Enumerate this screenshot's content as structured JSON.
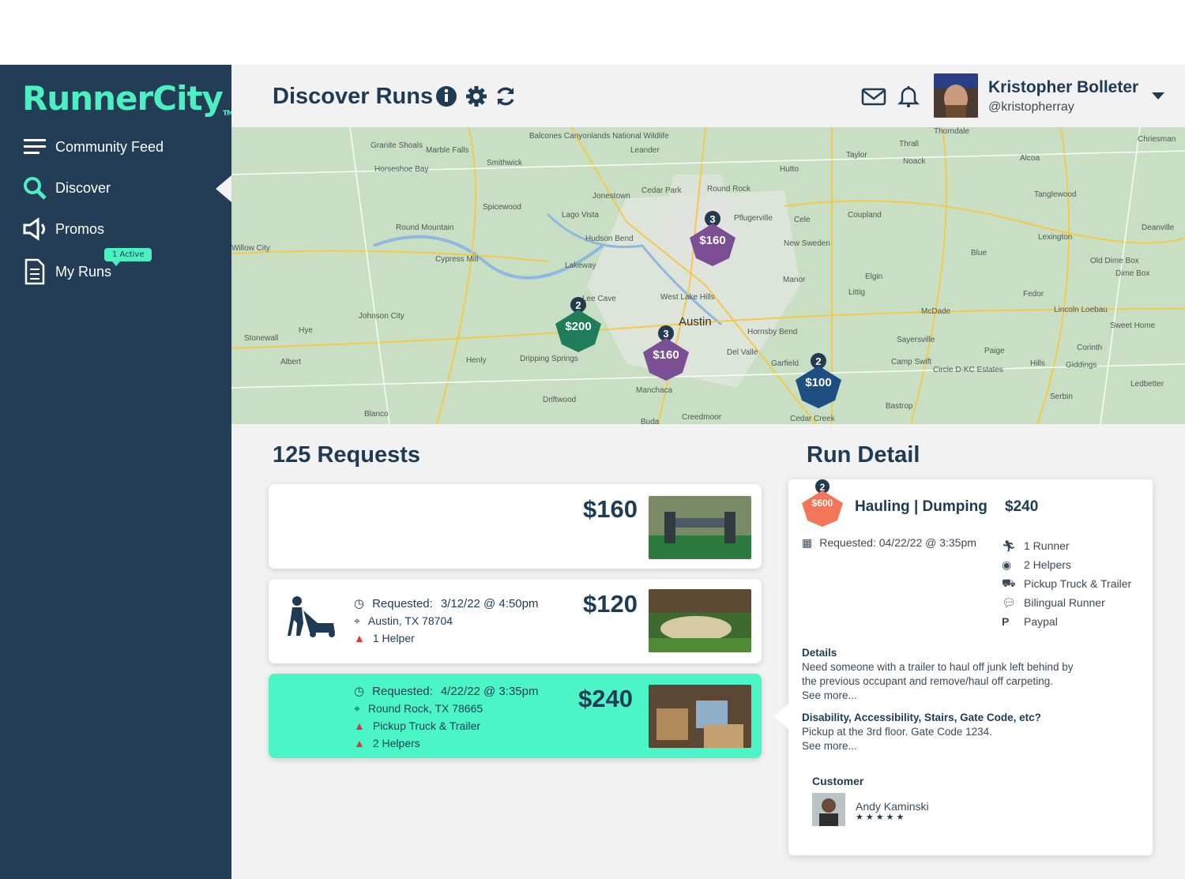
{
  "brand": {
    "name": "RunnerCity",
    "tm": "TM"
  },
  "sidebar": {
    "items": [
      {
        "label": "Community Feed",
        "icon": "menu-icon"
      },
      {
        "label": "Discover",
        "icon": "search-icon"
      },
      {
        "label": "Promos",
        "icon": "megaphone-icon"
      },
      {
        "label": "My Runs",
        "icon": "document-icon"
      }
    ],
    "my_runs_badge": "1 Active"
  },
  "header": {
    "title": "Discover Runs",
    "user_name": "Kristopher Bolleter",
    "user_handle": "@kristopherray"
  },
  "map": {
    "center_label": "Austin",
    "places": [
      "Thorndale",
      "Granite Shoals",
      "Marble Falls",
      "Balcones Canyonlands National Wildlife",
      "Horseshoe Bay",
      "Smithwick",
      "Leander",
      "Cedar Park",
      "Round Rock",
      "Jonestown",
      "Pflugerville",
      "Hutto",
      "Taylor",
      "Thrall",
      "Noack",
      "Alcoa",
      "Chriesman",
      "Tanglewood",
      "Coupland",
      "Spicewood",
      "Lago Vista",
      "Round Mountain",
      "Hudson Bend",
      "Cele",
      "New Sweden",
      "Lexington",
      "Deanville",
      "Cypress Mill",
      "Lakeway",
      "Manor",
      "Elgin",
      "Blue",
      "Old Dime Box",
      "Dime Box",
      "Willow City",
      "Lee Cave",
      "West Lake Hills",
      "Littig",
      "Fedor",
      "McDade",
      "Lincoln Loebau",
      "Johnson City",
      "Hornsby Bend",
      "Sweet Home",
      "Stonewall",
      "Hye",
      "Sayersville",
      "Corinth",
      "Albert",
      "Henly",
      "Dripping Springs",
      "Del Valle",
      "Garfield",
      "Paige",
      "Hills",
      "Giddings",
      "Camp Swift",
      "Circle D-KC Estates",
      "Ledbetter",
      "Manchaca",
      "Driftwood",
      "Bastrop",
      "Serbin",
      "Blanco",
      "Creedmoor",
      "Cedar Creek",
      "Buda"
    ],
    "pins": [
      {
        "count": "3",
        "price": "$160",
        "color": "#7c4f94"
      },
      {
        "count": "2",
        "price": "$200",
        "color": "#1f7d5a"
      },
      {
        "count": "3",
        "price": "$160",
        "color": "#7c4f94"
      },
      {
        "count": "2",
        "price": "$100",
        "color": "#1f4f82"
      }
    ]
  },
  "requests": {
    "title": "125 Requests",
    "cards": [
      {
        "price": "$160"
      },
      {
        "price": "$120",
        "requested_label": "Requested:",
        "requested": "3/12/22 @ 4:50pm",
        "location": "Austin, TX 78704",
        "tags": [
          "1 Helper"
        ]
      },
      {
        "price": "$240",
        "requested_label": "Requested:",
        "requested": "4/22/22 @ 3:35pm",
        "location": "Round Rock, TX 78665",
        "tags": [
          "Pickup Truck & Trailer",
          "2 Helpers"
        ]
      }
    ]
  },
  "detail": {
    "title": "Run Detail",
    "badge_count": "2",
    "badge_price": "$600",
    "category": "Hauling | Dumping",
    "price": "$240",
    "requested": "Requested: 04/22/22 @ 3:35pm",
    "features": [
      "1 Runner",
      "2 Helpers",
      "Pickup Truck & Trailer",
      "Bilingual Runner",
      "Paypal"
    ],
    "details_label": "Details",
    "details_text": "Need someone with a trailer to haul off junk left behind by the previous occupant and remove/haul off carpeting.",
    "see_more": "See more...",
    "access_label": "Disability, Accessibility, Stairs, Gate Code, etc?",
    "access_text": "Pickup at the 3rd floor. Gate Code 1234.",
    "see_more2": "See more...",
    "customer_label": "Customer",
    "customer_name": "Andy Kaminski",
    "stars": "★★★★★"
  },
  "colors": {
    "sidebar": "#223d55",
    "accent": "#4cf0c0",
    "selected": "#4cf5c6",
    "alert": "#d63a3a"
  }
}
